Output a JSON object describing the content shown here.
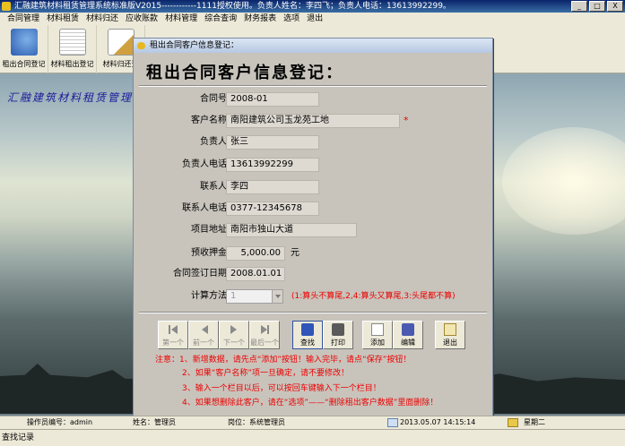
{
  "window": {
    "title": "汇融建筑材料租赁管理系统标准版V2015------------1111授权使用。负责人姓名：李四飞；负责人电话：13613992299。",
    "buttons": {
      "minimize": "_",
      "maximize": "□",
      "close": "X"
    }
  },
  "menu": [
    "合同管理",
    "材料租赁",
    "材料归还",
    "应收账款",
    "材料管理",
    "综合查询",
    "财务报表",
    "选项",
    "退出"
  ],
  "toolbar": [
    "租出合同登记",
    "材料租出登记",
    "材料归还登"
  ],
  "banner": "汇融建筑材料租赁管理",
  "dialog": {
    "title": "租出合同客户信息登记：",
    "heading": "租出合同客户信息登记：",
    "fields": {
      "contract_no": {
        "label": "合同号：",
        "value": "2008-01"
      },
      "customer_name": {
        "label": "客户名称：",
        "value": "南阳建筑公司玉龙苑工地",
        "required": "*"
      },
      "manager": {
        "label": "负责人：",
        "value": "张三"
      },
      "manager_phone": {
        "label": "负责人电话：",
        "value": "13613992299"
      },
      "contact": {
        "label": "联系人：",
        "value": "李四"
      },
      "contact_phone": {
        "label": "联系人电话：",
        "value": "0377-12345678"
      },
      "project_address": {
        "label": "项目地址：",
        "value": "南阳市独山大道"
      },
      "deposit": {
        "label": "预收押金：",
        "value": "5,000.00",
        "unit": "元"
      },
      "sign_date": {
        "label": "合同签订日期：",
        "value": "2008.01.01"
      },
      "calc_method": {
        "label": "计算方法：",
        "value": "1",
        "hint": "(1:算头不算尾,2,4:算头又算尾,3:头尾都不算)"
      }
    },
    "actions": {
      "first": "第一个",
      "prev": "前一个",
      "next": "下一个",
      "last": "最后一个",
      "find": "查找",
      "print": "打印",
      "add": "添加",
      "edit": "编辑",
      "exit": "退出"
    },
    "notes": [
      "注意：1、新增数据，请先点“添加”按钮！输入完毕，请点“保存”按钮！",
      "2、如果“客户名称”项一旦确定，请不要修改！",
      "3、输入一个栏目以后，可以按回车键输入下一个栏目！",
      "4、如果想删除此客户，请在“选项”——“删除租出客户数据”里面删除！"
    ]
  },
  "status": {
    "operator": "操作员编号：admin",
    "name": "姓名：管理员",
    "post": "岗位：系统管理员",
    "datetime": "2013.05.07 14:15:14",
    "weekday": "星期二",
    "log": "查找记录"
  },
  "colors": {
    "accent_red": "#e00000",
    "title_blue": "#0a246a"
  }
}
